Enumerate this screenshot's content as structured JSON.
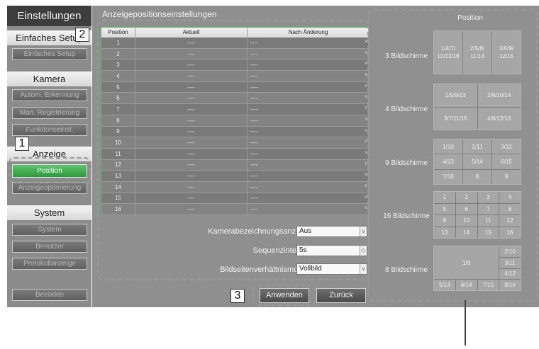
{
  "sidebar": {
    "title": "Einstellungen",
    "sections": [
      {
        "header": "Einfaches Setup",
        "buttons": [
          {
            "label": "Einfaches Setup",
            "active": false
          }
        ]
      },
      {
        "header": "Kamera",
        "buttons": [
          {
            "label": "Autom. Erkennung",
            "active": false
          },
          {
            "label": "Man. Registrierung",
            "active": false
          },
          {
            "label": "Funktionseinst.",
            "active": false
          }
        ]
      },
      {
        "header": "Anzeige",
        "buttons": [
          {
            "label": "Position",
            "active": true
          },
          {
            "label": "Anzeigeoptimierung",
            "active": false
          }
        ]
      },
      {
        "header": "System",
        "buttons": [
          {
            "label": "System",
            "active": false
          },
          {
            "label": "Benutzer",
            "active": false
          },
          {
            "label": "Protokollanzeige",
            "active": false
          }
        ]
      }
    ],
    "exit_label": "Beenden"
  },
  "main": {
    "title": "Anzeigepositionseinstellungen",
    "table": {
      "headers": [
        "Position",
        "Aktuell",
        "Nach Änderung"
      ],
      "rows": [
        {
          "position": "1",
          "aktuell": "----",
          "nach": "----"
        },
        {
          "position": "2",
          "aktuell": "----",
          "nach": "----"
        },
        {
          "position": "3",
          "aktuell": "----",
          "nach": "----"
        },
        {
          "position": "4",
          "aktuell": "----",
          "nach": "----"
        },
        {
          "position": "5",
          "aktuell": "----",
          "nach": "----"
        },
        {
          "position": "6",
          "aktuell": "----",
          "nach": "----"
        },
        {
          "position": "7",
          "aktuell": "----",
          "nach": "----"
        },
        {
          "position": "8",
          "aktuell": "----",
          "nach": "----"
        },
        {
          "position": "9",
          "aktuell": "----",
          "nach": "----"
        },
        {
          "position": "10",
          "aktuell": "----",
          "nach": "----"
        },
        {
          "position": "11",
          "aktuell": "----",
          "nach": "----"
        },
        {
          "position": "12",
          "aktuell": "----",
          "nach": "----"
        },
        {
          "position": "13",
          "aktuell": "----",
          "nach": "----"
        },
        {
          "position": "14",
          "aktuell": "----",
          "nach": "----"
        },
        {
          "position": "15",
          "aktuell": "----",
          "nach": "----"
        },
        {
          "position": "16",
          "aktuell": "----",
          "nach": "----"
        }
      ]
    },
    "settings": [
      {
        "label": "Kamerabezeichnungsanzeige",
        "value": "Aus",
        "control": "dropdown"
      },
      {
        "label": "Sequenzintervall",
        "value": "5s",
        "control": "spinner"
      },
      {
        "label": "Bildseitenverhältnismodus",
        "value": "Vollbild",
        "control": "dropdown"
      }
    ],
    "apply_label": "Anwenden",
    "back_label": "Zurück"
  },
  "layout_panel": {
    "title": "Position",
    "layouts": [
      {
        "name": "3 Bildschirme",
        "cells": [
          "1/4/7/\n10/13/16",
          "2/5/8/\n11/14",
          "3/6/9/\n12/15"
        ]
      },
      {
        "name": "4 Bildschirme",
        "cells": [
          "1/5/9/13",
          "2/6/10/14",
          "3/7/11/15",
          "4/8/12/16"
        ]
      },
      {
        "name": "9 Bildschirme",
        "cells": [
          "1/10",
          "2/11",
          "3/12",
          "4/13",
          "5/14",
          "6/15",
          "7/16",
          "8",
          "9"
        ]
      },
      {
        "name": "16 Bildschirme",
        "cells": [
          "1",
          "2",
          "3",
          "4",
          "5",
          "6",
          "7",
          "8",
          "9",
          "10",
          "11",
          "12",
          "13",
          "14",
          "15",
          "16"
        ]
      },
      {
        "name": "8 Bildschirme",
        "cells": [
          "1/9",
          "2/10",
          "3/11",
          "4/12",
          "5/13",
          "6/14",
          "7/15",
          "8/16"
        ]
      }
    ]
  },
  "callouts": [
    "1",
    "2",
    "3"
  ],
  "chevron": "v",
  "spinner": "◇",
  "colors": {
    "active": "#3fae4c",
    "panel": "#8f8f8f",
    "title_bar": "#3d3d3d"
  }
}
